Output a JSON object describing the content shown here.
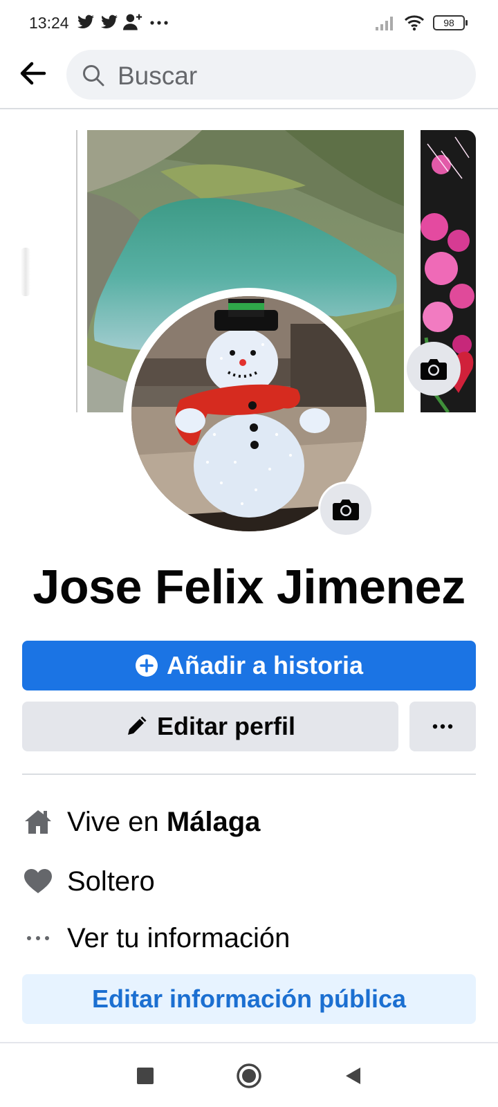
{
  "status_bar": {
    "time": "13:24",
    "notification_icons": [
      "twitter-icon",
      "twitter-icon",
      "add-friend-icon",
      "more-dots-icon"
    ],
    "battery": "98"
  },
  "search": {
    "placeholder": "Buscar"
  },
  "profile": {
    "name": "Jose Felix Jimenez"
  },
  "actions": {
    "story_label": "Añadir a historia",
    "edit_profile_label": "Editar perfil",
    "more_label": "···"
  },
  "info": {
    "lives_prefix": "Vive en ",
    "lives_city": "Málaga",
    "relationship": "Soltero",
    "see_info": "Ver tu información",
    "edit_public_label": "Editar información pública"
  },
  "colors": {
    "primary": "#1b74e4",
    "secondary_button": "#e4e6eb",
    "light_blue_button": "#e7f3ff",
    "link_text": "#1b6fd1"
  }
}
